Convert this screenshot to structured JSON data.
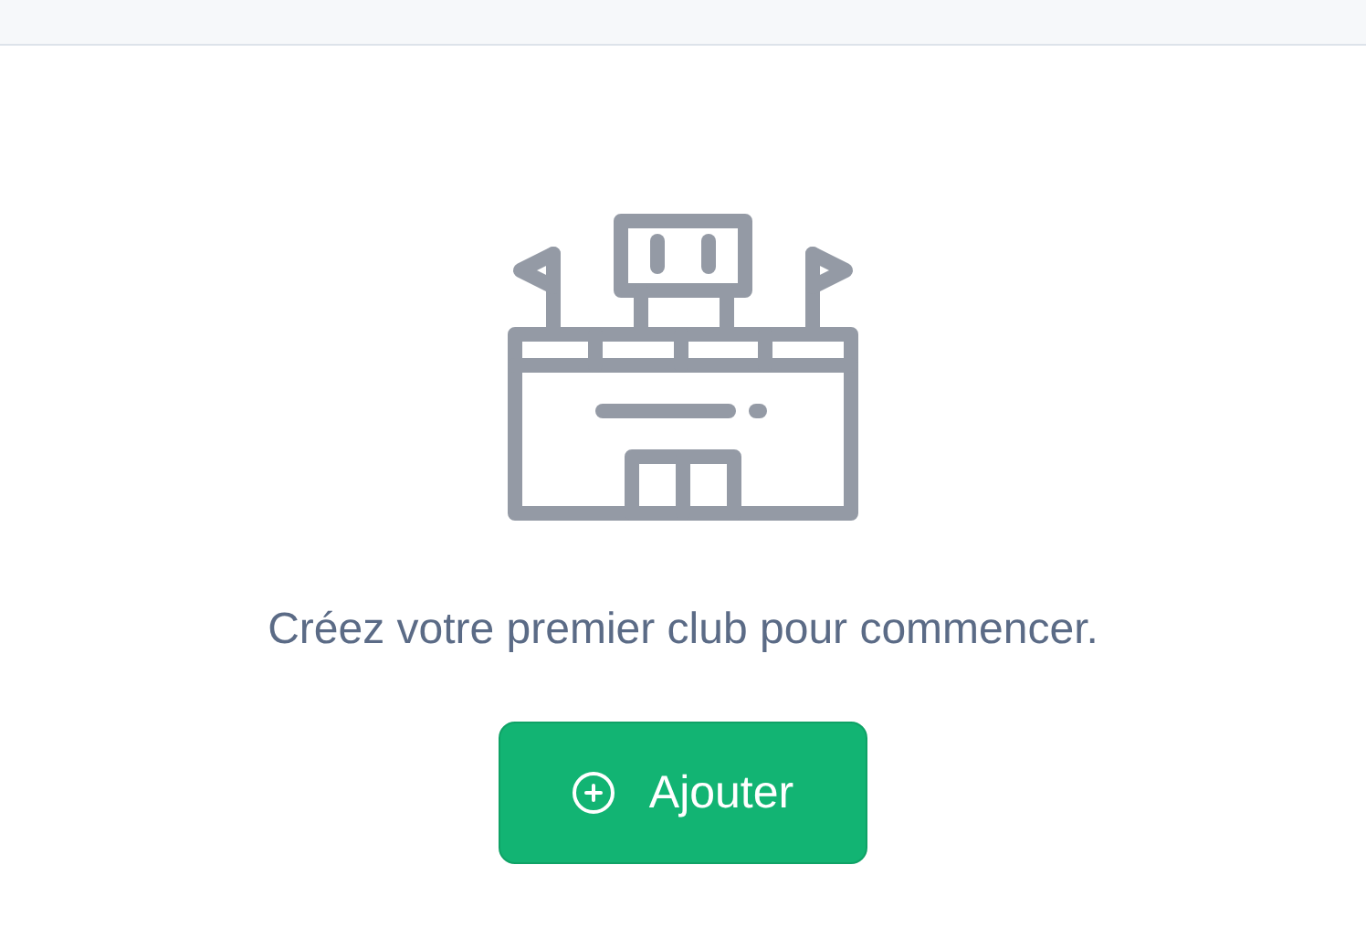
{
  "empty_state": {
    "message": "Créez votre premier club pour commencer.",
    "add_button": {
      "label": "Ajouter"
    }
  }
}
